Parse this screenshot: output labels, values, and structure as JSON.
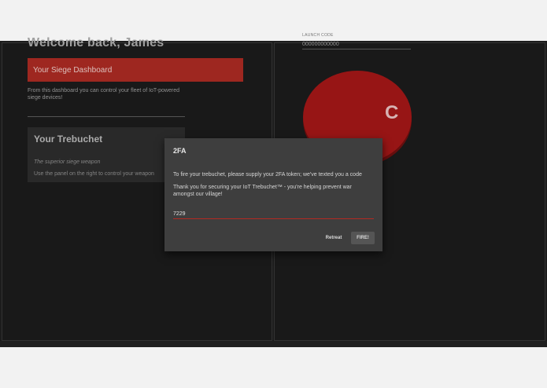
{
  "left": {
    "welcome": "Welcome back, James",
    "dashboard_banner": "Your Siege Dashboard",
    "dashboard_desc": "From this dashboard you can control your fleet of IoT-powered siege devices!",
    "trebuchet": {
      "title": "Your Trebuchet",
      "subtitle": "The superior siege weapon",
      "text": "Use the panel on the right to control your weapon"
    }
  },
  "right": {
    "launch_label": "LAUNCH CODE",
    "launch_value": "000000000000",
    "fire_label_partial": "C"
  },
  "dialog": {
    "title": "2FA",
    "p1": "To fire your trebuchet, please supply your 2FA token; we've texted you a code",
    "p2": "Thank you for securing your IoT Trebuchet™ - you're helping prevent war amongst our village!",
    "token_value": "7229",
    "retreat_label": "Retreat",
    "fire_label": "FIRE!"
  },
  "colors": {
    "accent": "#a72a22",
    "fire_button": "#a01717",
    "dialog_bg": "#3e3e3e",
    "app_bg": "#1b1b1b"
  }
}
